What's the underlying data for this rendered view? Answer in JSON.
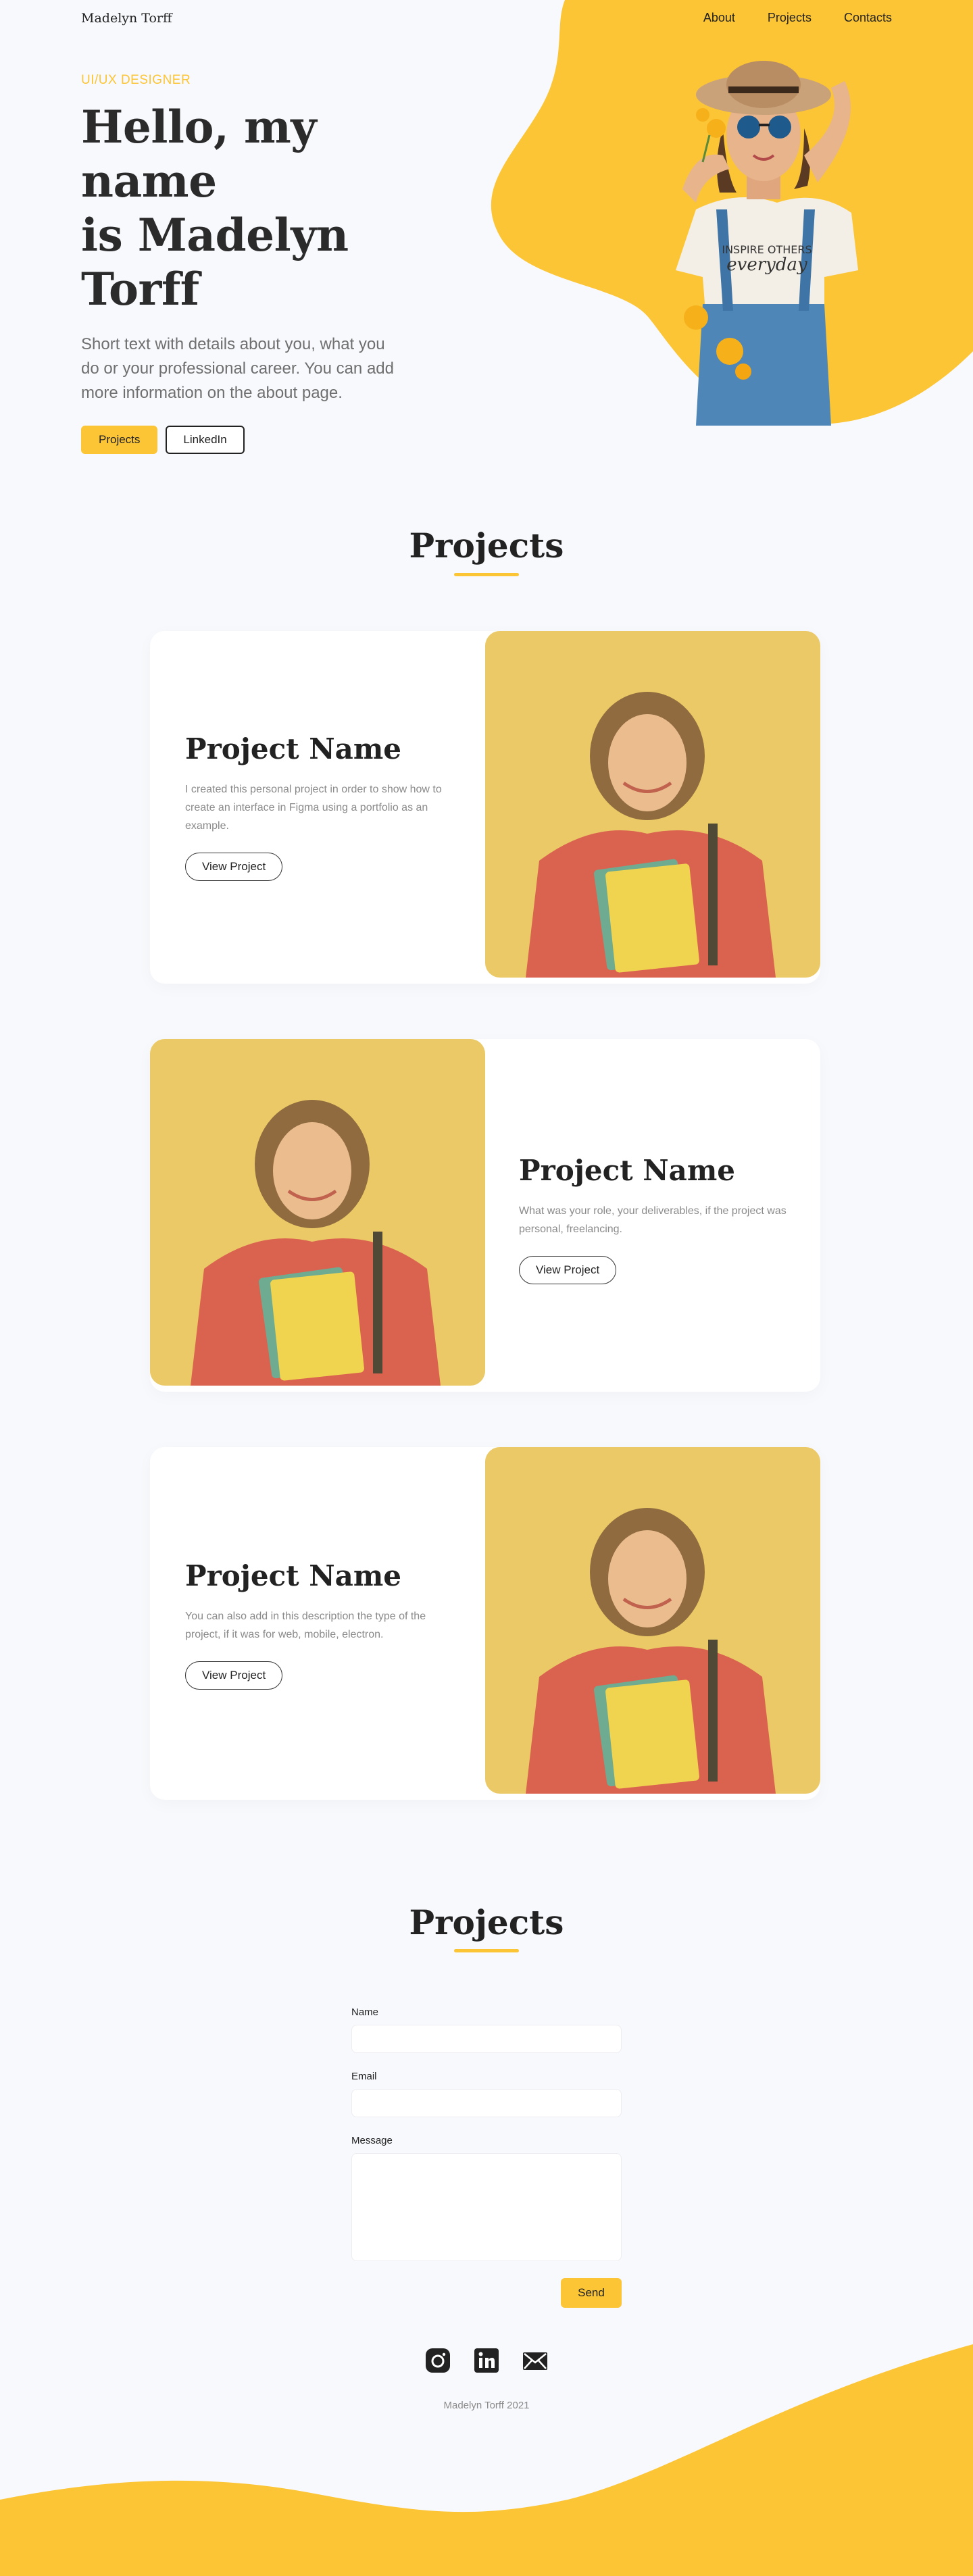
{
  "nav": {
    "brand": "Madelyn Torff",
    "links": [
      "About",
      "Projects",
      "Contacts"
    ]
  },
  "hero": {
    "role": "UI/UX DESIGNER",
    "title_line1": "Hello,  my name",
    "title_line2": "is Madelyn Torff",
    "description": "Short text with details about you, what you do or your professional career. You can add more information on the about page.",
    "primary_button": "Projects",
    "secondary_button": "LinkedIn",
    "tshirt_text": "INSPIRE OTHERS"
  },
  "projects": {
    "title": "Projects",
    "items": [
      {
        "name": "Project Name",
        "description": "I created this personal project in order to show how to create an interface in Figma using a portfolio as an example.",
        "button": "View Project"
      },
      {
        "name": "Project Name",
        "description": "What was your role, your deliverables, if the project was personal, freelancing.",
        "button": "View Project"
      },
      {
        "name": "Project Name",
        "description": "You can also add in this description the type of the project, if it was for web, mobile, electron.",
        "button": "View Project"
      }
    ]
  },
  "contact": {
    "title": "Projects",
    "name_label": "Name",
    "email_label": "Email",
    "message_label": "Message",
    "send_button": "Send"
  },
  "footer": {
    "icons": [
      "instagram-icon",
      "linkedin-icon",
      "email-icon"
    ],
    "copyright": "Madelyn Torff 2021"
  },
  "colors": {
    "accent": "#fcc536",
    "background": "#f8f9fd",
    "text": "#222222"
  }
}
